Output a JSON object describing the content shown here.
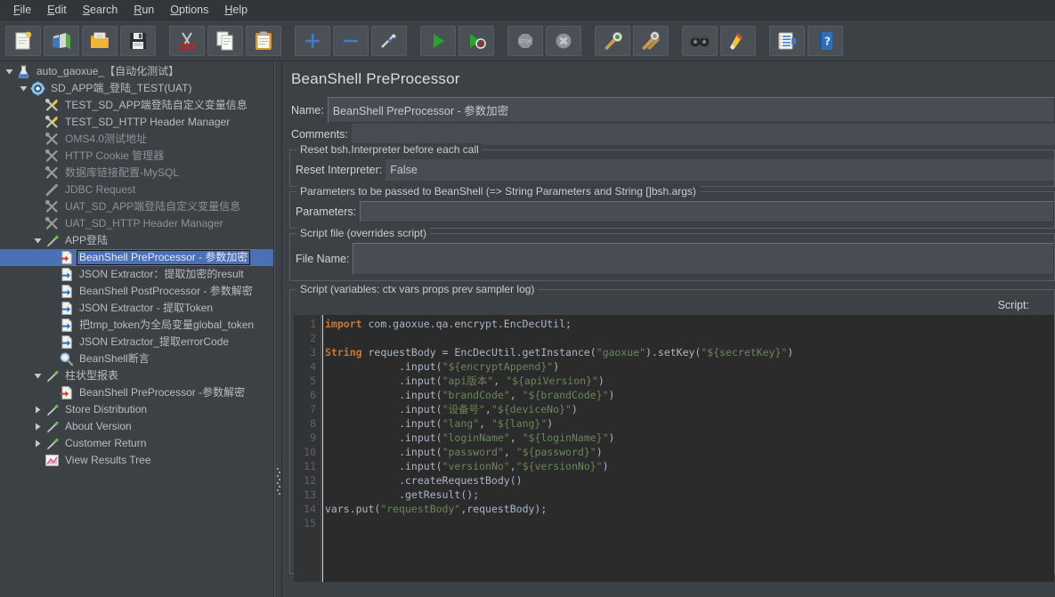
{
  "menubar": {
    "items": [
      {
        "label": "File",
        "mnemonic": "F"
      },
      {
        "label": "Edit",
        "mnemonic": "E"
      },
      {
        "label": "Search",
        "mnemonic": "S"
      },
      {
        "label": "Run",
        "mnemonic": "R"
      },
      {
        "label": "Options",
        "mnemonic": "O"
      },
      {
        "label": "Help",
        "mnemonic": "H"
      }
    ]
  },
  "toolbar": {
    "buttons": [
      {
        "name": "new-test-plan-icon",
        "tooltip": "New"
      },
      {
        "name": "templates-icon",
        "tooltip": "Templates"
      },
      {
        "name": "open-icon",
        "tooltip": "Open"
      },
      {
        "name": "save-icon",
        "tooltip": "Save Test Plan"
      },
      {
        "name": "cut-icon",
        "tooltip": "Cut"
      },
      {
        "name": "copy-icon",
        "tooltip": "Copy"
      },
      {
        "name": "paste-icon",
        "tooltip": "Paste"
      },
      {
        "name": "expand-all-icon",
        "tooltip": "Expand All"
      },
      {
        "name": "collapse-all-icon",
        "tooltip": "Collapse All"
      },
      {
        "name": "toggle-icon",
        "tooltip": "Toggle"
      },
      {
        "name": "start-icon",
        "tooltip": "Start"
      },
      {
        "name": "start-no-pauses-icon",
        "tooltip": "Start no pauses"
      },
      {
        "name": "stop-icon",
        "tooltip": "Stop"
      },
      {
        "name": "shutdown-icon",
        "tooltip": "Shutdown"
      },
      {
        "name": "clear-icon",
        "tooltip": "Clear"
      },
      {
        "name": "clear-all-icon",
        "tooltip": "Clear All"
      },
      {
        "name": "search-icon",
        "tooltip": "Search"
      },
      {
        "name": "reset-search-icon",
        "tooltip": "Reset Search"
      },
      {
        "name": "function-helper-icon",
        "tooltip": "Function Helper Dialog"
      },
      {
        "name": "help-icon",
        "tooltip": "Help"
      }
    ]
  },
  "tree": {
    "nodes": [
      {
        "label": "auto_gaoxue_【自动化测试】",
        "indent": 0,
        "twist": "down",
        "icon": "test-plan-icon",
        "selected": false,
        "disabled": false
      },
      {
        "label": "SD_APP端_登陆_TEST(UAT)",
        "indent": 1,
        "twist": "down",
        "icon": "thread-group-icon",
        "selected": false,
        "disabled": false
      },
      {
        "label": "TEST_SD_APP端登陆自定义变量信息",
        "indent": 2,
        "twist": "none",
        "icon": "config-element-icon",
        "selected": false,
        "disabled": false
      },
      {
        "label": "TEST_SD_HTTP Header Manager",
        "indent": 2,
        "twist": "none",
        "icon": "config-element-icon",
        "selected": false,
        "disabled": false
      },
      {
        "label": "OMS4.0测试地址",
        "indent": 2,
        "twist": "none",
        "icon": "config-element-icon",
        "selected": false,
        "disabled": true
      },
      {
        "label": "HTTP Cookie 管理器",
        "indent": 2,
        "twist": "none",
        "icon": "config-element-icon",
        "selected": false,
        "disabled": true
      },
      {
        "label": "数据库链接配置-MySQL",
        "indent": 2,
        "twist": "none",
        "icon": "config-element-icon",
        "selected": false,
        "disabled": true
      },
      {
        "label": "JDBC Request",
        "indent": 2,
        "twist": "none",
        "icon": "jdbc-request-icon",
        "selected": false,
        "disabled": true
      },
      {
        "label": "UAT_SD_APP端登陆自定义变量信息",
        "indent": 2,
        "twist": "none",
        "icon": "config-element-icon",
        "selected": false,
        "disabled": true
      },
      {
        "label": "UAT_SD_HTTP Header Manager",
        "indent": 2,
        "twist": "none",
        "icon": "config-element-icon",
        "selected": false,
        "disabled": true
      },
      {
        "label": "APP登陆",
        "indent": 2,
        "twist": "down",
        "icon": "http-sampler-icon",
        "selected": false,
        "disabled": false
      },
      {
        "label": "BeanShell PreProcessor - 参数加密",
        "indent": 3,
        "twist": "none",
        "icon": "preprocessor-icon",
        "selected": true,
        "disabled": false
      },
      {
        "label": "JSON Extractor：提取加密的result",
        "indent": 3,
        "twist": "none",
        "icon": "postprocessor-icon",
        "selected": false,
        "disabled": false
      },
      {
        "label": "BeanShell PostProcessor - 参数解密",
        "indent": 3,
        "twist": "none",
        "icon": "postprocessor-icon",
        "selected": false,
        "disabled": false
      },
      {
        "label": "JSON Extractor - 提取Token",
        "indent": 3,
        "twist": "none",
        "icon": "postprocessor-icon",
        "selected": false,
        "disabled": false
      },
      {
        "label": "把tmp_token为全局变量global_token",
        "indent": 3,
        "twist": "none",
        "icon": "postprocessor-icon",
        "selected": false,
        "disabled": false
      },
      {
        "label": "JSON Extractor_提取errorCode",
        "indent": 3,
        "twist": "none",
        "icon": "postprocessor-icon",
        "selected": false,
        "disabled": false
      },
      {
        "label": "BeanShell断言",
        "indent": 3,
        "twist": "none",
        "icon": "assertion-icon",
        "selected": false,
        "disabled": false
      },
      {
        "label": "柱状型报表",
        "indent": 2,
        "twist": "down",
        "icon": "http-sampler-icon",
        "selected": false,
        "disabled": false
      },
      {
        "label": "BeanShell PreProcessor -参数解密",
        "indent": 3,
        "twist": "none",
        "icon": "preprocessor-icon",
        "selected": false,
        "disabled": false
      },
      {
        "label": "Store Distribution",
        "indent": 2,
        "twist": "right",
        "icon": "http-sampler-icon",
        "selected": false,
        "disabled": false
      },
      {
        "label": "About Version",
        "indent": 2,
        "twist": "right",
        "icon": "http-sampler-icon",
        "selected": false,
        "disabled": false
      },
      {
        "label": "Customer Return",
        "indent": 2,
        "twist": "right",
        "icon": "http-sampler-icon",
        "selected": false,
        "disabled": false
      },
      {
        "label": "View Results Tree",
        "indent": 2,
        "twist": "none",
        "icon": "view-results-tree-icon",
        "selected": false,
        "disabled": false
      }
    ]
  },
  "panel": {
    "title": "BeanShell PreProcessor",
    "name_label": "Name:",
    "name_value": "BeanShell PreProcessor - 参数加密",
    "comments_label": "Comments:",
    "comments_value": "",
    "reset_group_title": "Reset bsh.Interpreter before each call",
    "reset_label": "Reset Interpreter:",
    "reset_value": "False",
    "parameters_group_title": "Parameters to be passed to BeanShell (=> String Parameters and String []bsh.args)",
    "parameters_label": "Parameters:",
    "parameters_value": "",
    "scriptfile_group_title": "Script file (overrides script)",
    "filename_label": "File Name:",
    "filename_value": "",
    "script_group_title": "Script (variables: ctx vars props prev sampler log)",
    "script_label": "Script:"
  },
  "editor": {
    "line_numbers": [
      "1",
      "2",
      "3",
      "4",
      "5",
      "6",
      "7",
      "8",
      "9",
      "10",
      "11",
      "12",
      "13",
      "14",
      "15"
    ],
    "lines": [
      "import com.gaoxue.qa.encrypt.EncDecUtil;",
      "",
      "String requestBody = EncDecUtil.getInstance(\"gaoxue\").setKey(\"${secretKey}\")",
      "            .input(\"${encryptAppend}\")",
      "            .input(\"api版本\", \"${apiVersion}\")",
      "            .input(\"brandCode\", \"${brandCode}\")",
      "            .input(\"设备号\",\"${deviceNo}\")",
      "            .input(\"lang\", \"${lang}\")",
      "            .input(\"loginName\", \"${loginName}\")",
      "            .input(\"password\", \"${password}\")",
      "            .input(\"versionNo\",\"${versionNo}\")",
      "            .createRequestBody()",
      "            .getResult();",
      "vars.put(\"requestBody\",requestBody);",
      ""
    ]
  },
  "colors": {
    "window_bg": "#3c4146",
    "menubar_bg": "#31363b",
    "selection_blue": "#4a70b8",
    "editor_bg": "#2b2b2b",
    "gutter_bg": "#313335",
    "keyword": "#cc7832",
    "string": "#6a8759",
    "code_text": "#a9b7c6",
    "label_text": "#d0d3d7",
    "tree_text": "#b9bdc2"
  }
}
